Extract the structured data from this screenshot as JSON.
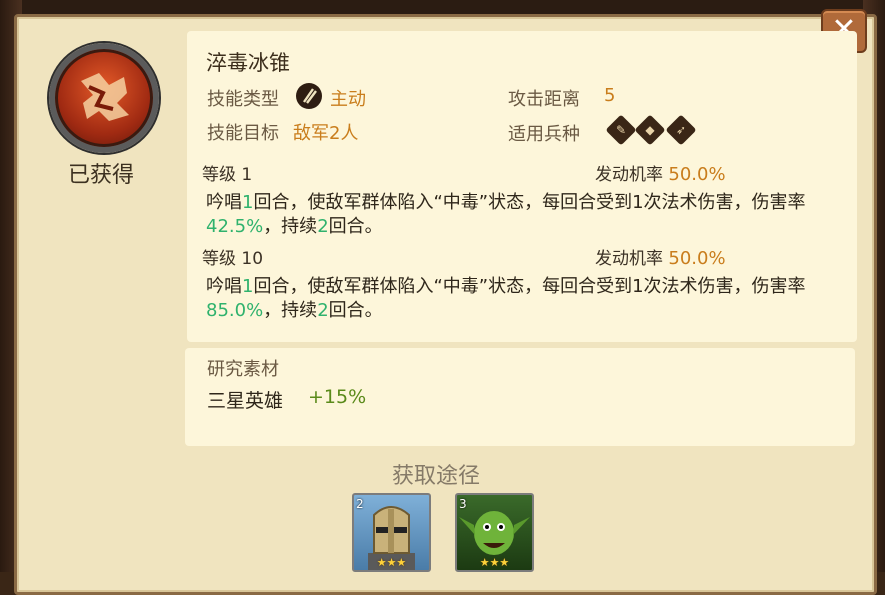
{
  "dialog": {
    "close_label": "✕",
    "obtained_label": "已获得"
  },
  "skill": {
    "name": "淬毒冰锥",
    "type_label": "技能类型",
    "type_value": "主动",
    "range_label": "攻击距离",
    "range_value": "5",
    "target_label": "技能目标",
    "target_value": "敌军2人",
    "troop_label": "适用兵种",
    "troop_icons": [
      "infantry-icon",
      "cavalry-icon",
      "archer-icon"
    ]
  },
  "levels": [
    {
      "level_label": "等级",
      "level_value": "1",
      "chance_label": "发动机率",
      "chance_value": "50.0%",
      "desc_a": "吟唱",
      "desc_turns": "1",
      "desc_b": "回合，使敌军群体陷入“中毒”状态，每回合受到1次法术伤害，伤害率",
      "desc_rate": "42.5%",
      "desc_c": "，持续",
      "desc_duration": "2",
      "desc_d": "回合。"
    },
    {
      "level_label": "等级",
      "level_value": "10",
      "chance_label": "发动机率",
      "chance_value": "50.0%",
      "desc_a": "吟唱",
      "desc_turns": "1",
      "desc_b": "回合，使敌军群体陷入“中毒”状态，每回合受到1次法术伤害，伤害率",
      "desc_rate": "85.0%",
      "desc_c": "，持续",
      "desc_duration": "2",
      "desc_d": "回合。"
    }
  ],
  "research": {
    "title": "研究素材",
    "item_label": "三星英雄",
    "item_value": "+15%"
  },
  "sources": {
    "title": "获取途径",
    "heroes": [
      {
        "level": "2",
        "stars": "★★★"
      },
      {
        "level": "3",
        "stars": "★★★"
      }
    ]
  },
  "colors": {
    "accent_orange": "#c97d1c",
    "accent_green": "#2fb26d",
    "research_green": "#5a8a1a"
  }
}
